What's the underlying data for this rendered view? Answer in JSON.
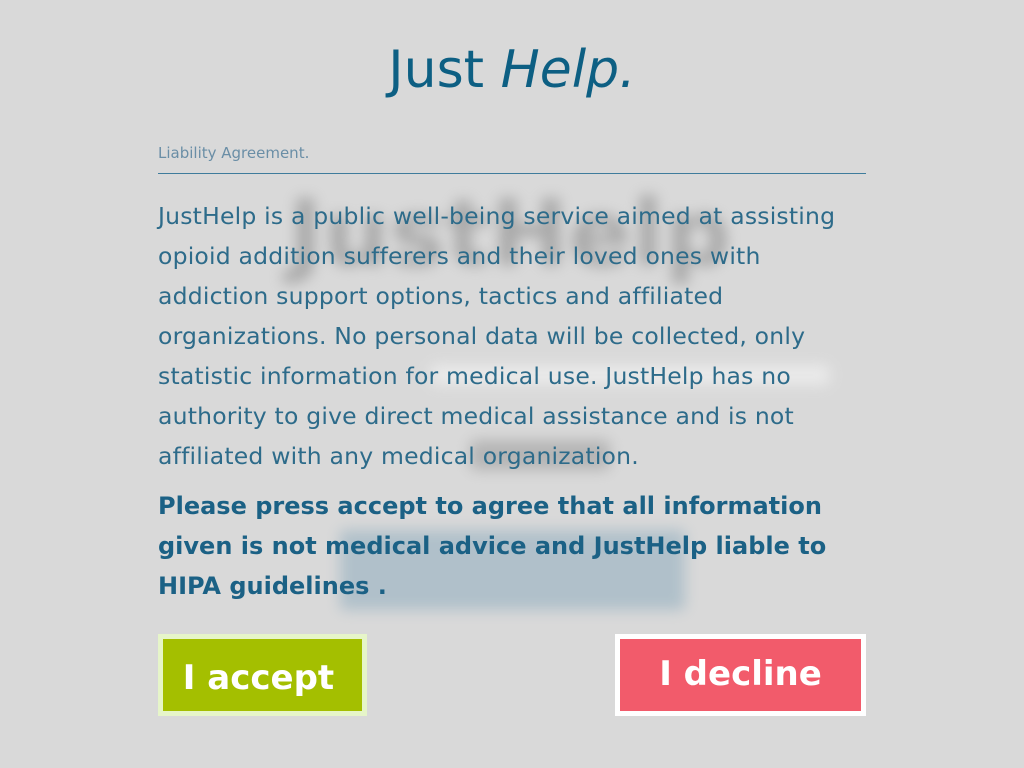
{
  "app": {
    "title_regular": "Just ",
    "title_italic": "Help.",
    "background_logo": "JustHelp"
  },
  "agreement": {
    "section_label": "Liability Agreement.",
    "body": "JustHelp is a public well-being service aimed at assisting opioid addition sufferers and their loved ones with addiction support options, tactics and affiliated organizations. No personal data will be collected, only statistic information for medical use. JustHelp has no authority to give direct medical assistance and is not affiliated with any medical organization.",
    "notice": "Please press accept to agree that all information given is not medical advice and JustHelp liable to HIPA guidelines ."
  },
  "actions": {
    "accept_label": "I accept",
    "decline_label": "I decline"
  },
  "colors": {
    "background": "#d9d9d9",
    "brand_blue": "#0d5f83",
    "accept_green": "#a4bf00",
    "decline_red": "#f25b6b"
  }
}
